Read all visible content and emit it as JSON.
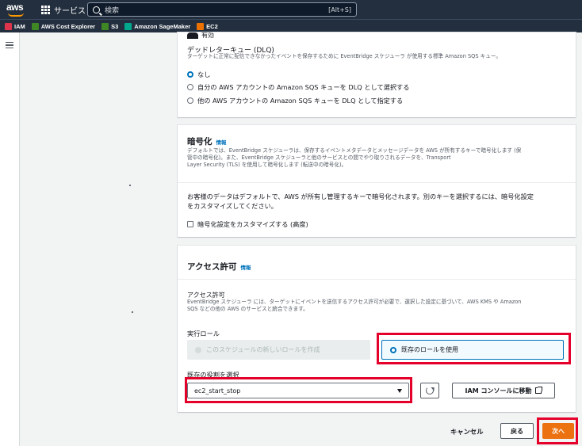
{
  "nav": {
    "services_label": "サービス",
    "search_placeholder": "検索",
    "search_shortcut": "[Alt+S]",
    "logo": "aws"
  },
  "favorites": [
    {
      "label": "IAM",
      "color": "#dd344c"
    },
    {
      "label": "AWS Cost Explorer",
      "color": "#3f8624"
    },
    {
      "label": "S3",
      "color": "#3f8624"
    },
    {
      "label": "Amazon SageMaker",
      "color": "#01a88d"
    },
    {
      "label": "EC2",
      "color": "#ed7100"
    }
  ],
  "dlq": {
    "cut_text": "有効",
    "title": "デッドレターキュー (DLQ)",
    "description": "ターゲットに正常に配信できなかったイベントを保存するために EventBridge スケジューラ が使用する標準 Amazon SQS キュー。",
    "options": [
      {
        "label": "なし",
        "selected": true
      },
      {
        "label": "自分の AWS アカウントの Amazon SQS キューを DLQ として選択する",
        "selected": false
      },
      {
        "label": "他の AWS アカウントの Amazon SQS キューを DLQ として指定する",
        "selected": false
      }
    ]
  },
  "encryption": {
    "title": "暗号化",
    "info": "情報",
    "description_1": "デフォルトでは、EventBridge スケジューラは、保存するイベントメタデータとメッセージデータを AWS が所有するキーで暗号化します (保",
    "description_2": "管中の暗号化)。また、EventBridge スケジューラと他のサービスとの間でやり取りされるデータを、Transport",
    "description_3": "Layer Security (TLS) を使用して暗号化します (転送中の暗号化)。",
    "notice_1": "お客様のデータはデフォルトで、AWS が所有し管理するキーで暗号化されます。別のキーを選択するには、暗号化設定",
    "notice_2": "をカスタマイズしてください。",
    "customize_label": "暗号化設定をカスタマイズする (高度)"
  },
  "access": {
    "title": "アクセス許可",
    "info": "情報",
    "field_title": "アクセス許可",
    "field_desc_1": "EventBridge スケジューラ には、ターゲットにイベントを送信するアクセス許可が必要で、選択した設定に基づいて、AWS KMS や Amazon",
    "field_desc_2": "SQS などの他の AWS のサービスと統合できます。",
    "exec_role_label": "実行ロール",
    "option_new": "このスケジュールの新しいロールを作成",
    "option_existing": "既存のロールを使用",
    "select_role_label": "既存の役割を選択",
    "selected_role": "ec2_start_stop",
    "iam_button": "IAM コンソールに移動"
  },
  "footer": {
    "cancel": "キャンセル",
    "back": "戻る",
    "next": "次へ"
  },
  "colors": {
    "accent": "#0073bb",
    "primary_button": "#ec7211",
    "highlight": "#e4002b",
    "nav_bg": "#232f3e"
  }
}
